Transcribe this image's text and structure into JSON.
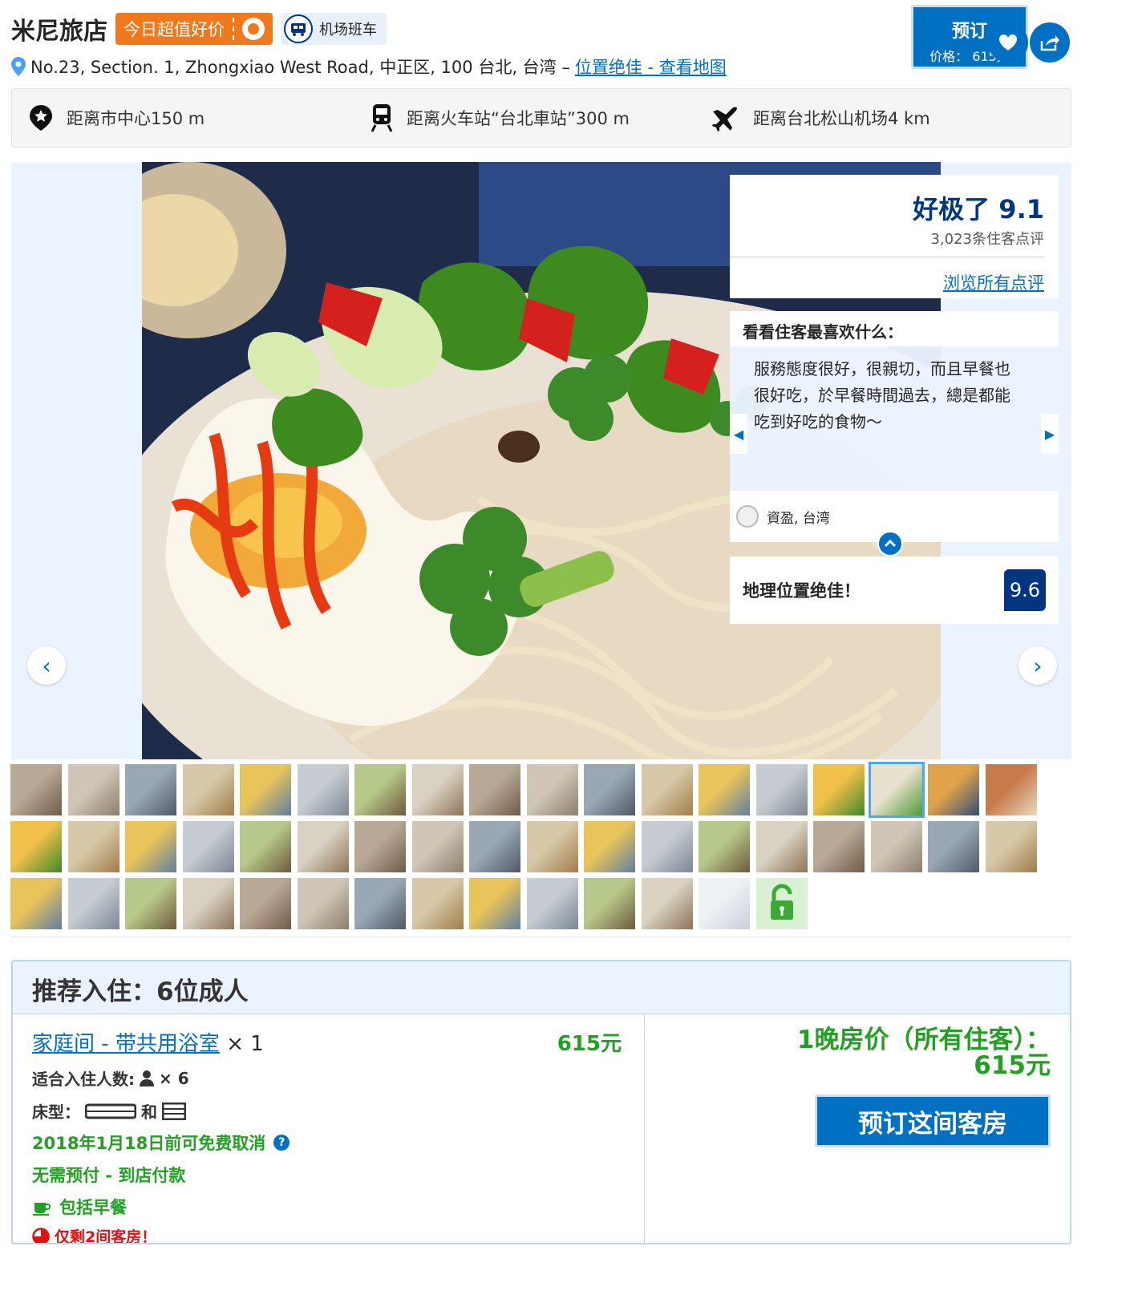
{
  "header": {
    "hotel_name": "米尼旅店",
    "deal_badge": "今日超值好价",
    "shuttle_label": "机场班车",
    "address": "No.23, Section. 1, Zhongxiao West Road, 中正区, 100 台北, 台湾 –",
    "location_link": "位置绝佳 - 查看地图",
    "book_button": {
      "label": "预订",
      "price_label": "价格： 615元"
    }
  },
  "distances": [
    {
      "icon": "landmark-star-icon",
      "text": "距离市中心150 m"
    },
    {
      "icon": "train-icon",
      "text": "距离火车站“台北車站”300 m"
    },
    {
      "icon": "airplane-icon",
      "text": "距离台北松山机场4 km"
    }
  ],
  "reviews": {
    "score_label": "好极了 9.1",
    "review_count": "3,023条住客点评",
    "all_reviews_link": "浏览所有点评",
    "favorites_heading": "看看住客最喜欢什么：",
    "quote": "服務態度很好，很親切，而且早餐也很好吃，於早餐時間過去，總是都能吃到好吃的食物～",
    "reviewer": "資盈, 台湾",
    "location_label": "地理位置绝佳！",
    "location_score": "9.6"
  },
  "recommendation": {
    "heading": "推荐入住：6位成人",
    "room_name": "家庭间 - 带共用浴室",
    "room_qty": "× 1",
    "room_price": "615元",
    "occupancy_label": "适合入住人数:",
    "occupancy_value": "× 6",
    "bed_label": "床型：",
    "bed_and": "和",
    "free_cancel": "2018年1月18日前可免费取消",
    "no_prepay": "无需预付 - 到店付款",
    "breakfast": "包括早餐",
    "scarcity": "仅剩2间客房！",
    "night_price_label": "1晚房价（所有住客）：",
    "night_price_value": "615元",
    "book_room_button": "预订这间客房"
  },
  "colors": {
    "brand_blue": "#0071c2",
    "dark_blue": "#003580",
    "deal_orange": "#f0791e",
    "green": "#23a024",
    "red": "#e21111"
  }
}
